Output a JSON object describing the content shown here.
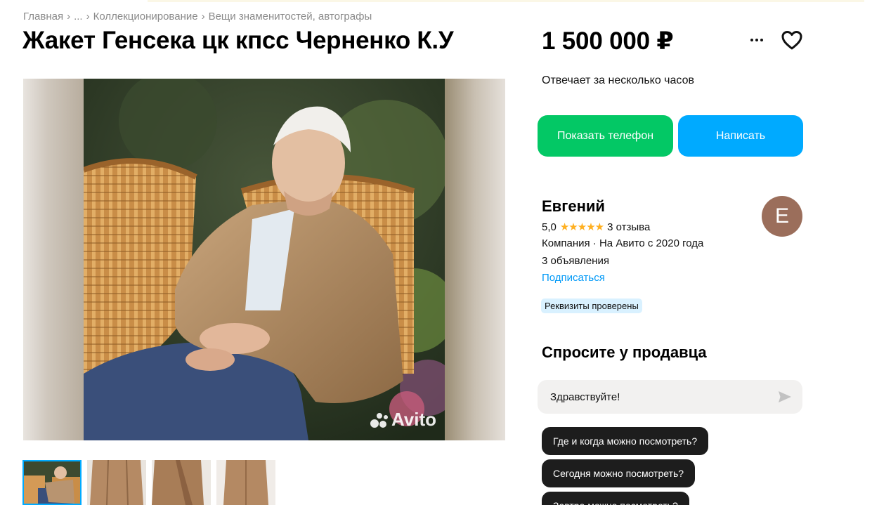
{
  "breadcrumb": {
    "items": [
      "Главная",
      "...",
      "Коллекционирование",
      "Вещи знаменитостей, автографы"
    ],
    "separator": "›"
  },
  "listing": {
    "title": "Жакет Генсека цк кпсс Черненко К.У",
    "price": "1 500 000 ₽",
    "response_time": "Отвечает за несколько часов"
  },
  "actions": {
    "show_phone": "Показать телефон",
    "write": "Написать",
    "more_icon": "more-dots-icon",
    "favorite_icon": "heart-icon"
  },
  "gallery": {
    "watermark": "Avito",
    "thumbnail_count": 4,
    "active_index": 0
  },
  "seller": {
    "name": "Евгений",
    "rating": "5,0",
    "stars": 5,
    "reviews": "3 отзыва",
    "company_line": "Компания · На Авито с 2020 года",
    "listings": "3 объявления",
    "subscribe": "Подписаться",
    "verified_badge": "Реквизиты проверены",
    "avatar_letter": "Е",
    "avatar_color": "#9b6e5b"
  },
  "ask": {
    "title": "Спросите у продавца",
    "input_value": "Здравствуйте!",
    "chips": [
      "Где и когда можно посмотреть?",
      "Сегодня можно посмотреть?",
      "Завтра можно посмотреть?"
    ]
  },
  "colors": {
    "green": "#03c865",
    "blue": "#00aaff",
    "link": "#0099f7",
    "star": "#ffb021"
  }
}
